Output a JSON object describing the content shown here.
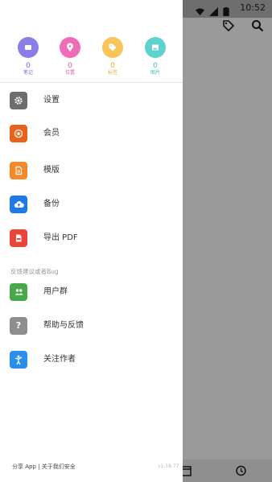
{
  "status_bar": {
    "time": "10:52"
  },
  "stats": [
    {
      "value": "0",
      "label": "笔记",
      "color": "#8a7ee6",
      "text_color": "#7a6ee0",
      "icon": "note-icon"
    },
    {
      "value": "0",
      "label": "位置",
      "color": "#ef6cb8",
      "text_color": "#e45aa8",
      "icon": "location-icon"
    },
    {
      "value": "0",
      "label": "标签",
      "color": "#f7c559",
      "text_color": "#e5ae38",
      "icon": "tag-icon"
    },
    {
      "value": "0",
      "label": "图片",
      "color": "#5fd1cf",
      "text_color": "#3fbfbd",
      "icon": "image-icon"
    }
  ],
  "menu": [
    {
      "label": "设置",
      "color": "#6d6d6d",
      "icon": "gear-icon"
    },
    {
      "label": "会员",
      "color": "#e9621c",
      "icon": "member-icon"
    },
    {
      "label": "模版",
      "color": "#f3892a",
      "icon": "template-icon"
    },
    {
      "label": "备份",
      "color": "#1e7be6",
      "icon": "cloud-upload-icon"
    },
    {
      "label": "导出 PDF",
      "color": "#e8463a",
      "icon": "pdf-icon"
    }
  ],
  "feedback_section": {
    "header": "反馈建议或者Bug",
    "items": [
      {
        "label": "用户群",
        "color": "#4aa84c",
        "icon": "group-icon"
      },
      {
        "label": "帮助与反馈",
        "color": "#8e8e8e",
        "icon": "help-icon"
      },
      {
        "label": "关注作者",
        "color": "#2a8fe8",
        "icon": "follow-icon"
      }
    ]
  },
  "footer": {
    "text": "分享 App | 关于我们安全",
    "version": "v1.18.77"
  }
}
